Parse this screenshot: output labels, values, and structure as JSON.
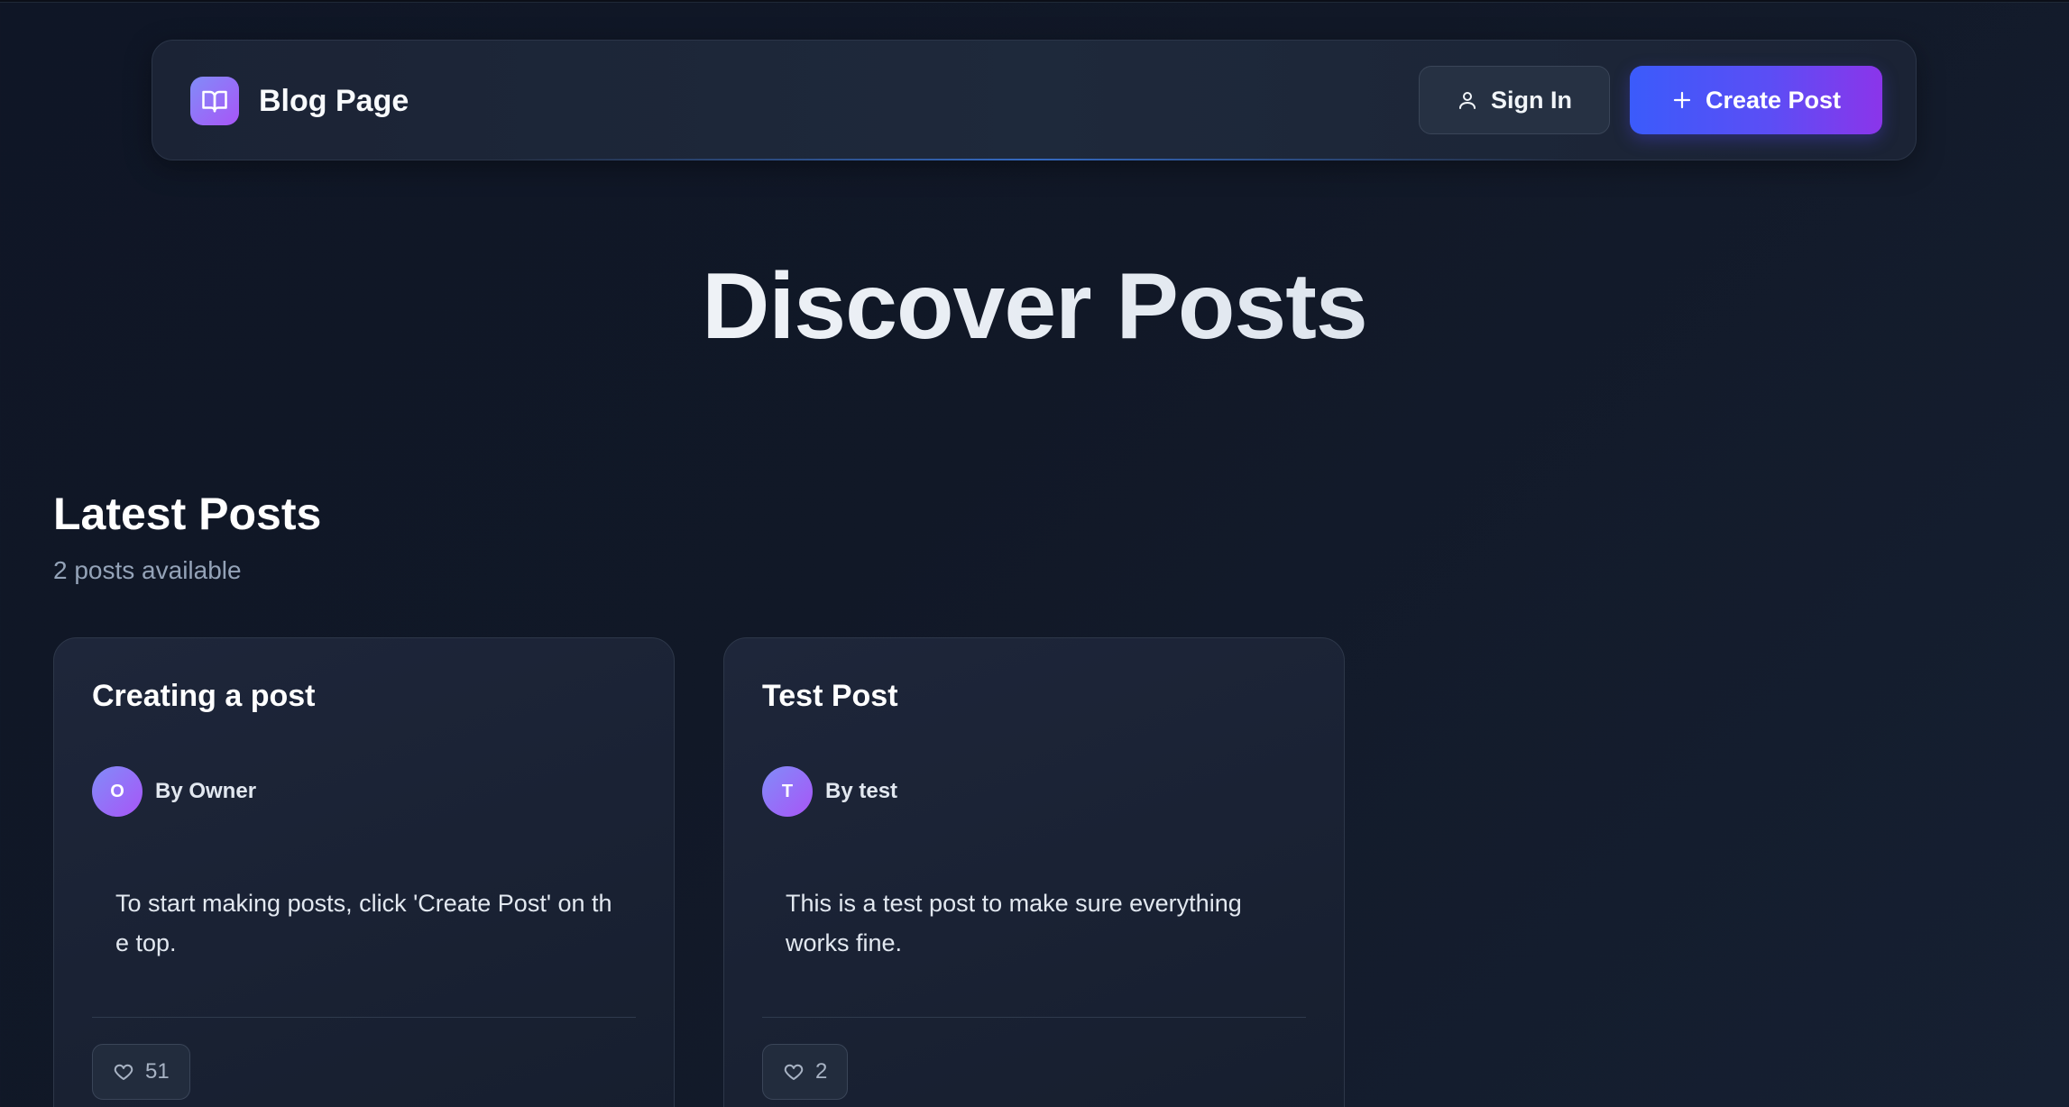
{
  "header": {
    "brand_title": "Blog Page",
    "signin_label": "Sign In",
    "create_label": "Create Post"
  },
  "hero": {
    "title": "Discover Posts"
  },
  "section": {
    "title": "Latest Posts",
    "subtitle": "2 posts available"
  },
  "posts": [
    {
      "title": "Creating a post",
      "avatar_initial": "O",
      "author": "By Owner",
      "body": "To start making posts, click 'Create Post' on the top.",
      "likes": "51"
    },
    {
      "title": "Test Post",
      "avatar_initial": "T",
      "author": "By test",
      "body": "This is a test post to make sure everything works fine.",
      "likes": "2"
    }
  ],
  "icons": {
    "logo": "book-open-icon",
    "signin": "user-icon",
    "create": "plus-icon",
    "like": "heart-icon"
  },
  "colors": {
    "background": "#111827",
    "accent_start": "#3b5bfb",
    "accent_end": "#8b35ea",
    "avatar_gradient_start": "#818cf8",
    "avatar_gradient_end": "#a855f7"
  }
}
